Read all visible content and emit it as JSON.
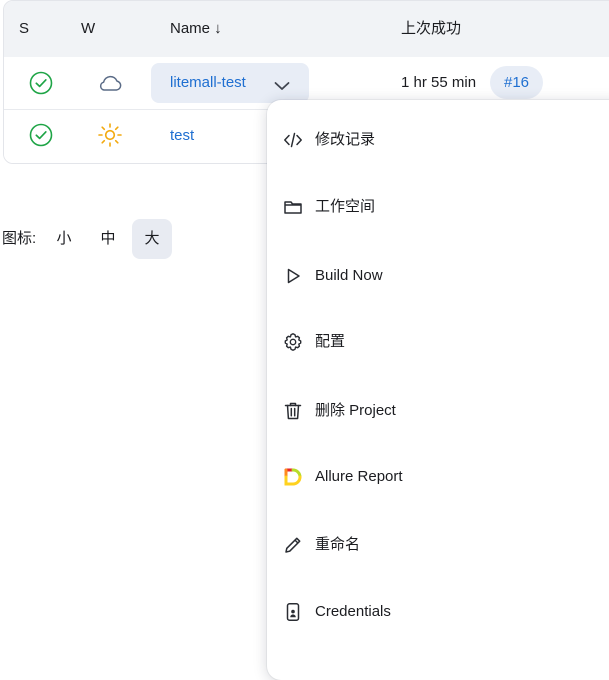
{
  "table": {
    "headers": {
      "status": "S",
      "weather": "W",
      "name": "Name ↓",
      "last_success": "上次成功"
    },
    "rows": [
      {
        "status_icon": "check-circle-icon",
        "weather_icon": "cloud-icon",
        "name": "litemall-test",
        "last_success": "1 hr 55 min",
        "build": "#16"
      },
      {
        "status_icon": "check-circle-icon",
        "weather_icon": "sun-icon",
        "name": "test"
      }
    ]
  },
  "icon_size": {
    "label": "图标:",
    "options": [
      "小",
      "中",
      "大"
    ],
    "selected": "大"
  },
  "dropdown": {
    "items": [
      {
        "icon": "code-icon",
        "label": "修改记录"
      },
      {
        "icon": "folder-icon",
        "label": "工作空间"
      },
      {
        "icon": "play-icon",
        "label": "Build Now"
      },
      {
        "icon": "gear-icon",
        "label": "配置"
      },
      {
        "icon": "trash-icon",
        "label": "删除 Project"
      },
      {
        "icon": "allure-icon",
        "label": "Allure Report"
      },
      {
        "icon": "pencil-icon",
        "label": "重命名"
      },
      {
        "icon": "credentials-icon",
        "label": "Credentials"
      }
    ]
  },
  "colors": {
    "link": "#1f6fd1",
    "success": "#1ea446",
    "sun": "#f2a90f",
    "cloud": "#5a6b86",
    "pill_bg": "#e8edf6"
  }
}
